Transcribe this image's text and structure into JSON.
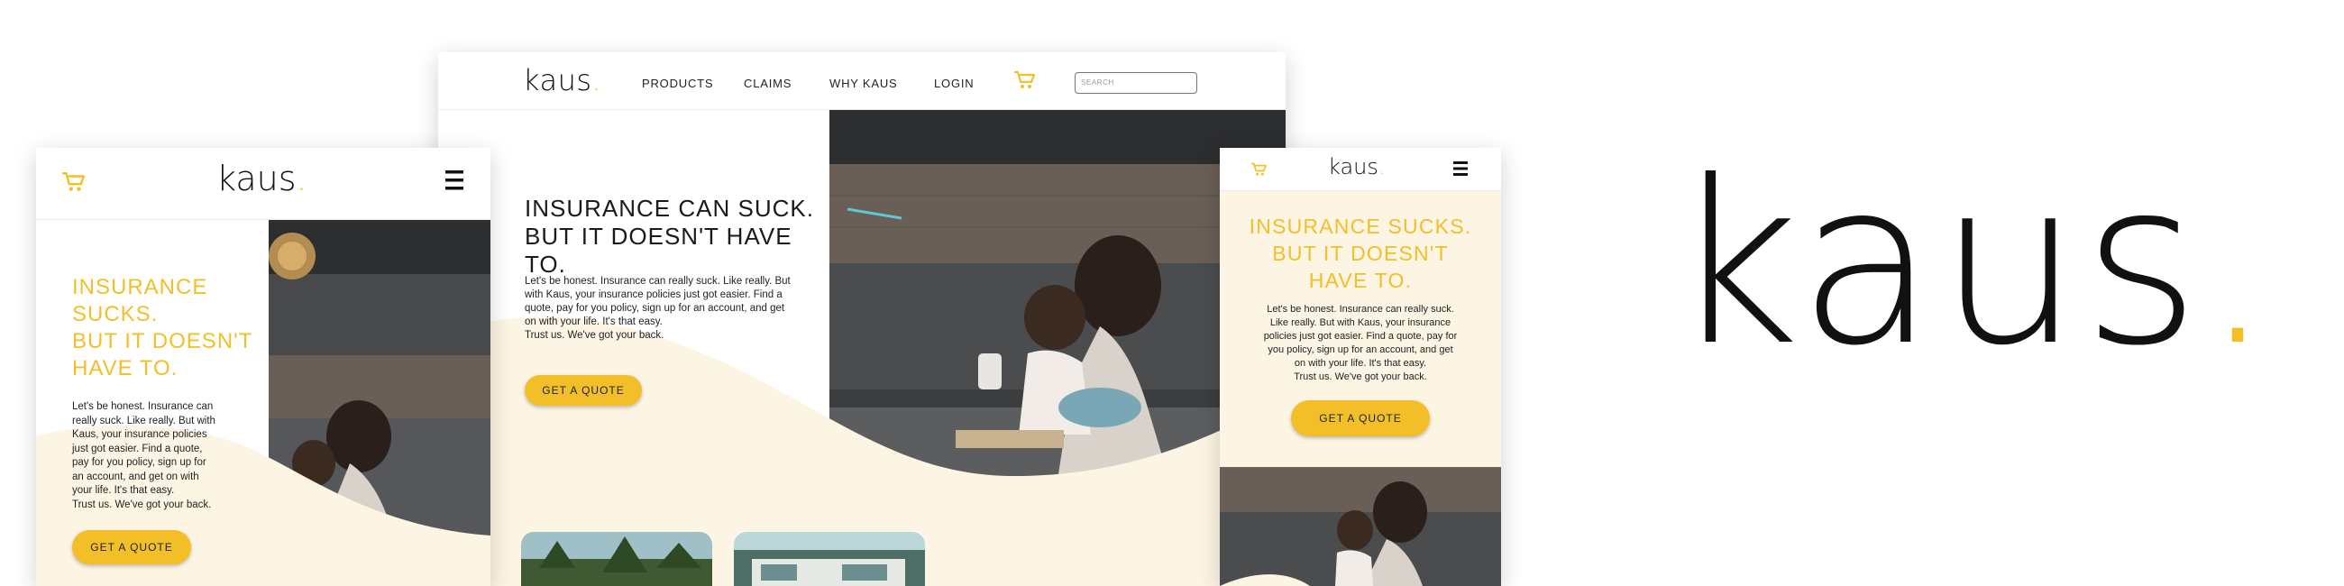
{
  "brand": {
    "logo_text": "kaus",
    "logo_dot": ".",
    "accent_color": "#f2bf29",
    "cream_color": "#fdf5e3",
    "text_color": "#1a1a1a"
  },
  "desktop": {
    "nav": {
      "links": [
        "PRODUCTS",
        "CLAIMS",
        "WHY KAUS",
        "LOGIN"
      ],
      "cart_icon": "cart-icon",
      "search_placeholder": "SEARCH"
    },
    "headline_line1": "INSURANCE CAN SUCK.",
    "headline_line2": "BUT IT DOESN'T HAVE TO.",
    "body_lines": [
      "Let's be honest. Insurance can really suck. Like really. But",
      "with Kaus, your insurance policies just got easier. Find a",
      "quote, pay for you policy, sign up for an account, and get",
      "on with your life. It's that easy.",
      "Trust us. We've got your back."
    ],
    "cta": "GET A QUOTE"
  },
  "mobile_left": {
    "headline": [
      "INSURANCE",
      "SUCKS.",
      "BUT IT DOESN'T",
      "HAVE TO."
    ],
    "body_lines": [
      "Let's be honest. Insurance can",
      "really suck. Like really. But with",
      "Kaus, your insurance policies",
      "just got easier. Find a quote,",
      "pay for you policy, sign up for",
      "an account, and get on with",
      "your life. It's that easy.",
      "Trust us. We've got your back."
    ],
    "cta": "GET A QUOTE",
    "cart_icon": "cart-icon",
    "menu_icon": "hamburger-menu-icon"
  },
  "mobile_right": {
    "headline": [
      "INSURANCE SUCKS.",
      "BUT IT DOESN'T",
      "HAVE TO."
    ],
    "body_lines": [
      "Let's be honest. Insurance can really suck.",
      "Like really. But with Kaus, your insurance",
      "policies just got easier. Find a quote, pay for",
      "you policy, sign up for an account, and get",
      "on with your life. It's that easy.",
      "Trust us. We've got your back."
    ],
    "cta": "GET A QUOTE",
    "cart_icon": "cart-icon",
    "menu_icon": "hamburger-menu-icon"
  }
}
